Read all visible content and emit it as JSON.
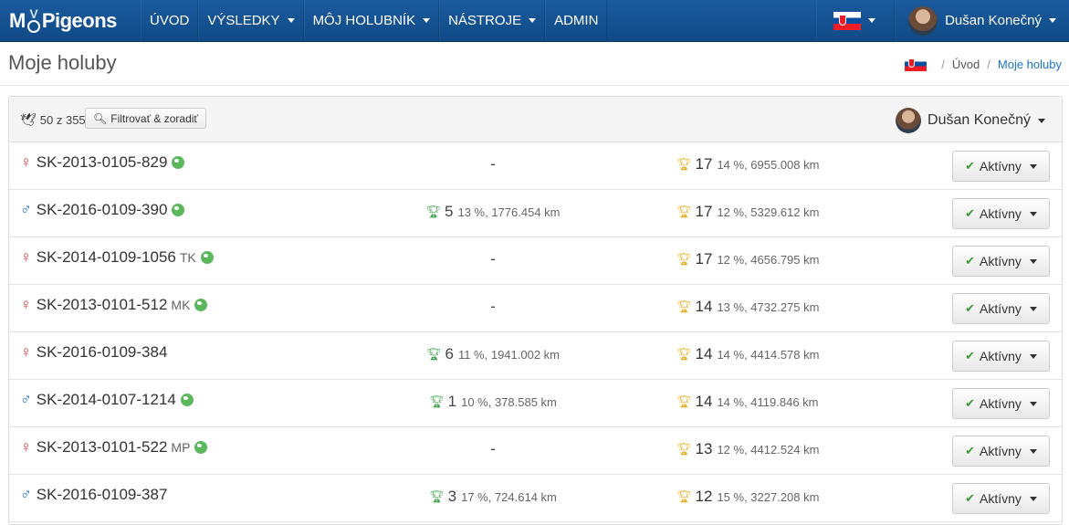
{
  "brand": {
    "before": "M",
    "after": "Pigeons"
  },
  "nav": {
    "uvod": "ÚVOD",
    "vysledky": "VÝSLEDKY",
    "holubnik": "MÔJ HOLUBNÍK",
    "nastroje": "NÁSTROJE",
    "admin": "ADMIN",
    "user": "Dušan Konečný"
  },
  "header": {
    "title": "Moje holuby",
    "breadcrumb": {
      "home": "Úvod",
      "current": "Moje holuby"
    }
  },
  "toolbar": {
    "count": "50 z 355",
    "filter_label": "Filtrovať & zoradiť",
    "owner": "Dušan Konečný"
  },
  "pigeons": [
    {
      "sex": "♀",
      "ring": "SK-2013-0105-829",
      "tag": "",
      "mid_num": "",
      "mid_detail": "",
      "right_num": "17",
      "right_detail": "14 %, 6955.008 km",
      "status": "Aktívny"
    },
    {
      "sex": "♂",
      "ring": "SK-2016-0109-390",
      "tag": "",
      "mid_num": "5",
      "mid_detail": "13 %, 1776.454 km",
      "right_num": "17",
      "right_detail": "12 %, 5329.612 km",
      "status": "Aktívny"
    },
    {
      "sex": "♀",
      "ring": "SK-2014-0109-1056",
      "tag": "TK",
      "mid_num": "",
      "mid_detail": "",
      "right_num": "17",
      "right_detail": "12 %, 4656.795 km",
      "status": "Aktívny"
    },
    {
      "sex": "♀",
      "ring": "SK-2013-0101-512",
      "tag": "MK",
      "mid_num": "",
      "mid_detail": "",
      "right_num": "14",
      "right_detail": "13 %, 4732.275 km",
      "status": "Aktívny"
    },
    {
      "sex": "♀",
      "ring": "SK-2016-0109-384",
      "tag": "",
      "mid_num": "6",
      "mid_detail": "11 %, 1941.002 km",
      "right_num": "14",
      "right_detail": "14 %, 4414.578 km",
      "status": "Aktívny"
    },
    {
      "sex": "♂",
      "ring": "SK-2014-0107-1214",
      "tag": "",
      "mid_num": "1",
      "mid_detail": "10 %, 378.585 km",
      "right_num": "14",
      "right_detail": "14 %, 4119.846 km",
      "status": "Aktívny"
    },
    {
      "sex": "♀",
      "ring": "SK-2013-0101-522",
      "tag": "MP",
      "mid_num": "",
      "mid_detail": "",
      "right_num": "13",
      "right_detail": "12 %, 4412.524 km",
      "status": "Aktívny"
    },
    {
      "sex": "♂",
      "ring": "SK-2016-0109-387",
      "tag": "",
      "mid_num": "3",
      "mid_detail": "17 %, 724.614 km",
      "right_num": "12",
      "right_detail": "15 %, 3227.208 km",
      "status": "Aktívny"
    }
  ],
  "empty_value": "-",
  "colors": {
    "navbar": "#125293",
    "female": "#e53935",
    "male": "#1e6fc5",
    "trophy_green": "#2e9e3e",
    "trophy_gold": "#e5a812",
    "link": "#1a73c8"
  },
  "icons": {
    "trophy": "trophy-icon",
    "globe": "globe-icon",
    "check": "check-icon",
    "bird": "bird-icon",
    "search": "search-icon"
  }
}
